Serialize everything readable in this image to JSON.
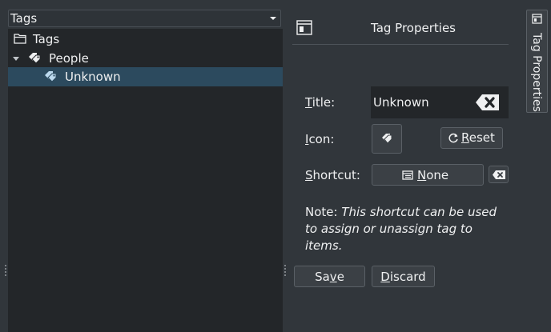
{
  "tree_panel": {
    "combo_label": "Tags",
    "items": [
      {
        "label": "Tags",
        "icon": "folder-icon"
      },
      {
        "label": "People",
        "icon": "tag-icon",
        "expanded": true
      },
      {
        "label": "Unknown",
        "icon": "tag-icon",
        "selected": true
      }
    ]
  },
  "props_panel": {
    "title": "Tag Properties",
    "title_label": {
      "pre": "",
      "u": "T",
      "post": "itle:"
    },
    "title_value": "Unknown",
    "icon_label": {
      "pre": "",
      "u": "I",
      "post": "con:"
    },
    "reset_label": {
      "pre": "",
      "u": "R",
      "post": "eset"
    },
    "shortcut_label": {
      "pre": "",
      "u": "S",
      "post": "hortcut:"
    },
    "shortcut_value": {
      "pre": "",
      "u": "N",
      "post": "one"
    },
    "note_prefix": "Note:",
    "note_text": "This shortcut can be used to assign or unassign tag to items.",
    "save_label": {
      "pre": "Sa",
      "u": "v",
      "post": "e"
    },
    "discard_label": {
      "pre": "",
      "u": "D",
      "post": "iscard"
    }
  },
  "dock_tab": {
    "label": "Tag Properties"
  },
  "colors": {
    "window_bg": "#31363b",
    "view_bg": "#232629",
    "selection": "#2c4a5e",
    "text": "#eff0f1"
  }
}
